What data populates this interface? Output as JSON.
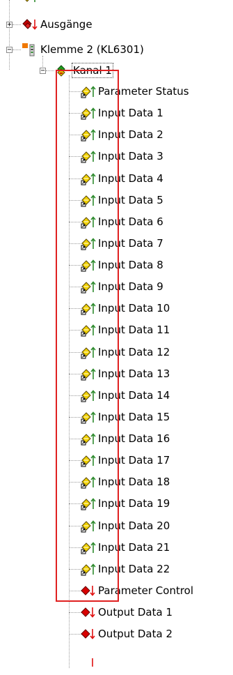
{
  "tree": {
    "top_items": [
      {
        "label": "",
        "type": "input-group",
        "partial": true
      },
      {
        "label": "Ausgänge",
        "type": "output-group",
        "expander": "+"
      },
      {
        "label": "Klemme 2 (KL6301)",
        "type": "terminal",
        "expander": "−"
      },
      {
        "label": "Kanal 1",
        "type": "channel",
        "expander": "−"
      }
    ],
    "channel_inputs": [
      "Parameter Status",
      "Input Data 1",
      "Input Data 2",
      "Input Data 3",
      "Input Data 4",
      "Input Data 5",
      "Input Data 6",
      "Input Data 7",
      "Input Data 8",
      "Input Data 9",
      "Input Data 10",
      "Input Data 11",
      "Input Data 12",
      "Input Data 13",
      "Input Data 14",
      "Input Data 15",
      "Input Data 16",
      "Input Data 17",
      "Input Data 18",
      "Input Data 19",
      "Input Data 20",
      "Input Data 21",
      "Input Data 22"
    ],
    "channel_outputs": [
      "Parameter Control",
      "Output Data 1",
      "Output Data 2"
    ]
  },
  "colors": {
    "highlight_box": "#e02020",
    "tree_lines": "#9a9a9a",
    "input_arrow": "#2e8b2e",
    "output_arrow": "#e01010"
  }
}
